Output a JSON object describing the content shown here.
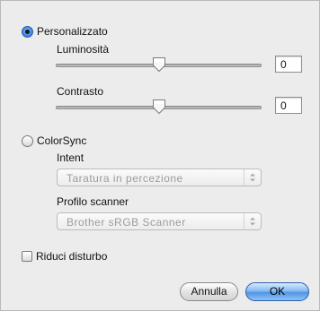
{
  "options": {
    "custom_label": "Personalizzato",
    "brightness": {
      "label": "Luminosità",
      "value": "0",
      "level": 0.5
    },
    "contrast": {
      "label": "Contrasto",
      "value": "0",
      "level": 0.5
    },
    "colorsync_label": "ColorSync",
    "intent": {
      "label": "Intent",
      "selected": "Taratura in percezione"
    },
    "scanner_profile": {
      "label": "Profilo scanner",
      "selected": "Brother sRGB Scanner"
    },
    "noise_reduction_label": "Riduci disturbo"
  },
  "buttons": {
    "cancel": "Annulla",
    "ok": "OK"
  },
  "colors": {
    "accent": "#4f92e3",
    "disabled_text": "#9c9c9c"
  }
}
